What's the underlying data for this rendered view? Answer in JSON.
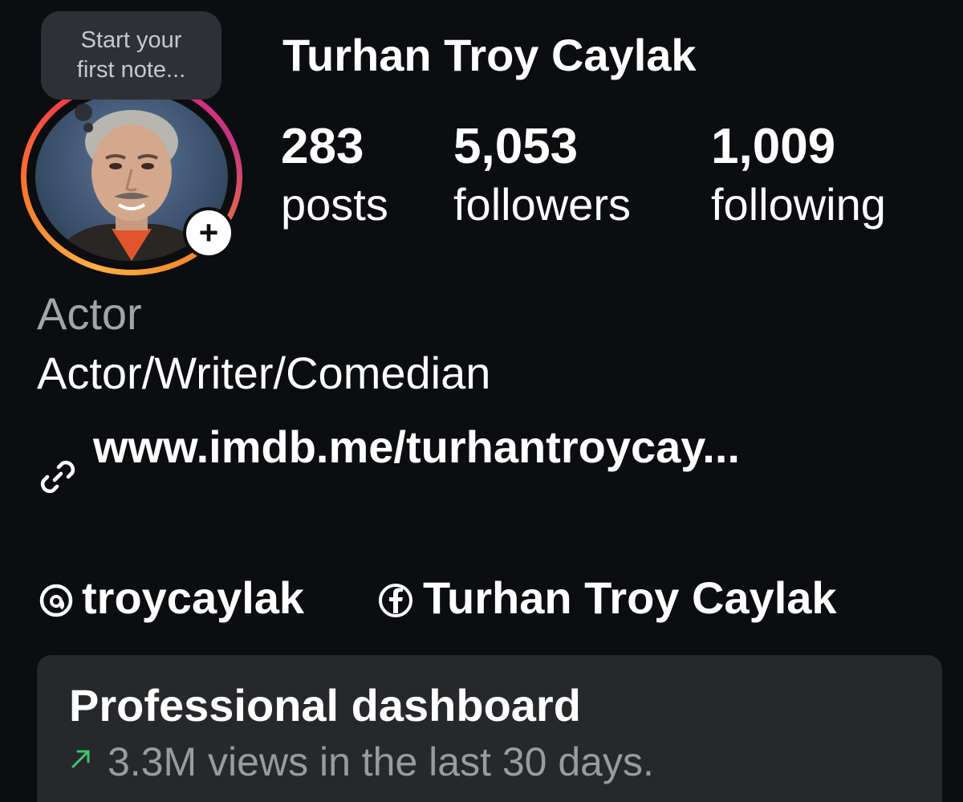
{
  "profile": {
    "display_name": "Turhan Troy Caylak",
    "note_placeholder": "Start your first note...",
    "add_story_glyph": "+",
    "avatar_icon": "profile-photo",
    "stats": {
      "posts": {
        "value": "283",
        "label": "posts"
      },
      "followers": {
        "value": "5,053",
        "label": "followers"
      },
      "following": {
        "value": "1,009",
        "label": "following"
      }
    }
  },
  "bio": {
    "category": "Actor",
    "description": "Actor/Writer/Comedian",
    "link_icon": "link-icon",
    "link_text": "www.imdb.me/turhantroycay..."
  },
  "social": {
    "threads": {
      "icon": "threads-icon",
      "handle": "troycaylak"
    },
    "facebook": {
      "icon": "facebook-icon",
      "name": "Turhan Troy Caylak"
    }
  },
  "dashboard": {
    "title": "Professional dashboard",
    "trend_icon": "trend-up-arrow-icon",
    "trend_color": "#3ec46d",
    "subtitle": "3.3M views in the last 30 days."
  },
  "colors": {
    "background": "#0c0d10",
    "card": "#26282c",
    "muted_text": "#a3a4aa",
    "note_bubble": "#2e3036"
  }
}
